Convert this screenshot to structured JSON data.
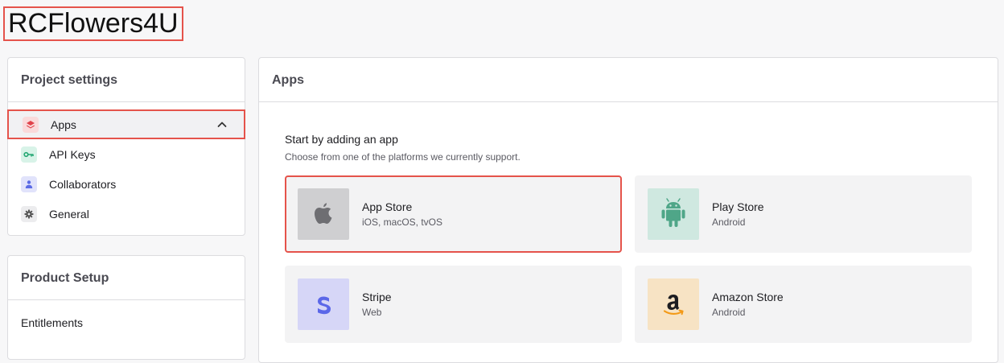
{
  "project": {
    "name": "RCFlowers4U"
  },
  "sidebar": {
    "title": "Project settings",
    "items": [
      {
        "label": "Apps",
        "icon": "layers-icon"
      },
      {
        "label": "API Keys",
        "icon": "key-icon"
      },
      {
        "label": "Collaborators",
        "icon": "person-icon"
      },
      {
        "label": "General",
        "icon": "gear-icon"
      }
    ]
  },
  "product_setup": {
    "title": "Product Setup",
    "items": [
      {
        "label": "Entitlements"
      }
    ]
  },
  "apps": {
    "title": "Apps",
    "intro_title": "Start by adding an app",
    "intro_subtitle": "Choose from one of the platforms we currently support.",
    "cards": [
      {
        "name": "App Store",
        "platforms": "iOS, macOS, tvOS",
        "icon": "apple-icon"
      },
      {
        "name": "Play Store",
        "platforms": "Android",
        "icon": "android-icon"
      },
      {
        "name": "Stripe",
        "platforms": "Web",
        "icon": "stripe-icon"
      },
      {
        "name": "Amazon Store",
        "platforms": "Android",
        "icon": "amazon-icon"
      }
    ]
  },
  "colors": {
    "highlight": "#e5534b",
    "apps_icon": "#e0434b",
    "keys_icon": "#25a874",
    "collab_icon": "#5b6be5",
    "stripe_bg": "#d6d6f7",
    "stripe_fg": "#5b67e8",
    "android_bg": "#cfe8e0",
    "android_fg": "#4fa688",
    "amazon_bg": "#f7e3c4",
    "amazon_fg": "#f39a18"
  }
}
